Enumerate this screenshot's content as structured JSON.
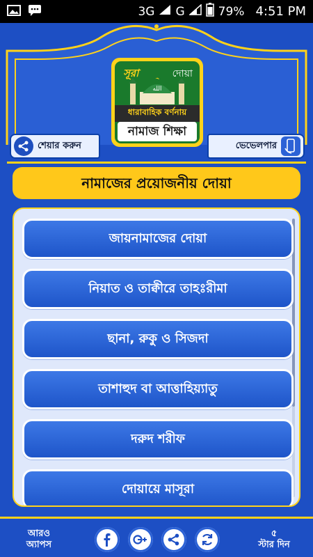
{
  "status_bar": {
    "network": "3G",
    "carrier": "G",
    "battery": "79%",
    "time": "4:51 PM"
  },
  "logo": {
    "top_left": "সূরা",
    "top_right": "দোয়া",
    "line1": "ধারাবাহিক বর্ণনায়",
    "line2": "নামাজ শিক্ষা",
    "dome_text": "الله"
  },
  "header": {
    "share_label": "শেয়ার করুন",
    "developer_label": "ভেভেলপার"
  },
  "title": "নামাজের প্রয়োজনীয় দোয়া",
  "items": [
    {
      "label": "জায়নামাজের দোয়া"
    },
    {
      "label": "নিয়াত ও তাক্বীরে তাহঃরীমা"
    },
    {
      "label": "ছানা, রুকু ও সিজদা"
    },
    {
      "label": "তাশাহুদ বা আত্তাহিয়্যাতু"
    },
    {
      "label": "দরুদ শরীফ"
    },
    {
      "label": "দোয়ায়ে মাসূরা"
    }
  ],
  "bottom": {
    "more_apps_line1": "আরও",
    "more_apps_line2": "অ্যাপস",
    "rate_line1": "৫",
    "rate_line2": "স্টার দিন"
  },
  "colors": {
    "primary": "#1d4fc4",
    "accent": "#ffd21a",
    "button": "#2f68dd"
  }
}
